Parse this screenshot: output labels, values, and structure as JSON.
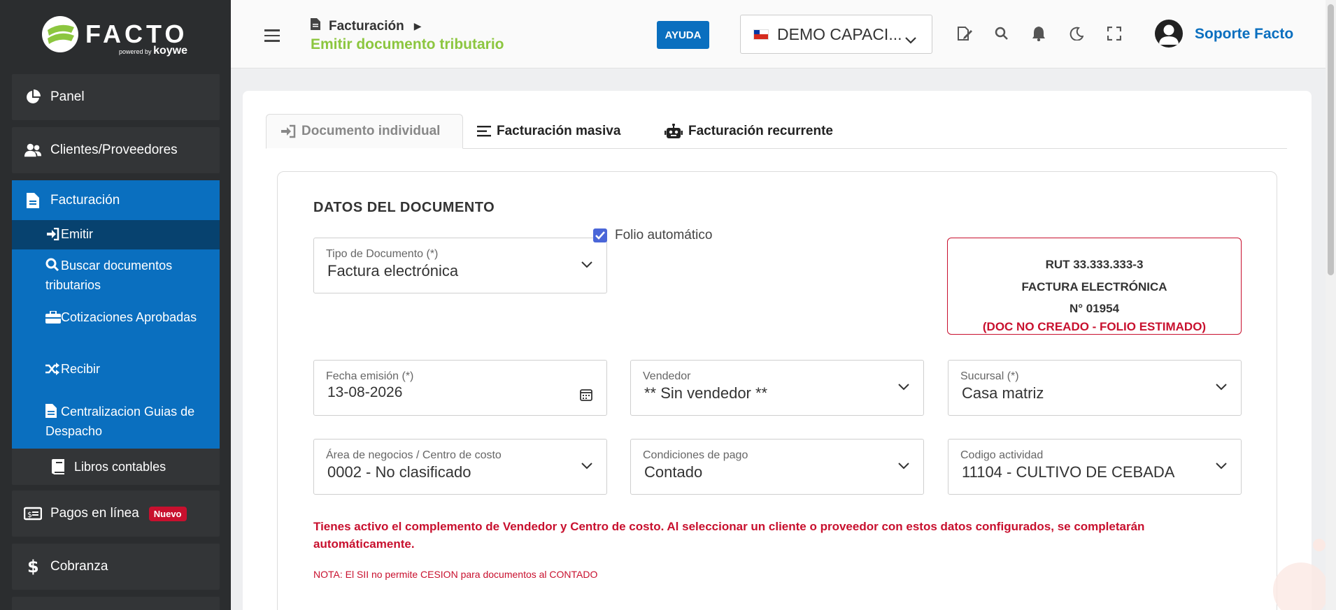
{
  "brand": {
    "name": "FACTO",
    "powered": "powered",
    "by": "by",
    "partner": "koywe"
  },
  "sidebar": {
    "items": [
      {
        "label": "Panel",
        "icon": "pie-chart-icon"
      },
      {
        "label": "Clientes/Proveedores",
        "icon": "users-icon"
      }
    ],
    "facturacion": {
      "label": "Facturación",
      "icon": "file-icon",
      "subitems": [
        {
          "label": "Emitir",
          "icon": "sign-in-icon",
          "active": true
        },
        {
          "label": "Buscar documentos tributarios",
          "icon": "search-icon"
        },
        {
          "label": "Cotizaciones Aprobadas",
          "icon": "briefcase-icon"
        },
        {
          "label": "Recibir",
          "icon": "shuffle-icon"
        },
        {
          "label": "Centralizacion Guias de Despacho",
          "icon": "file-icon"
        }
      ]
    },
    "libros": {
      "label": "Libros contables",
      "icon": "book-icon"
    },
    "pagos": {
      "label": "Pagos en línea",
      "badge": "Nuevo",
      "icon": "money-bill-icon"
    },
    "cobranza": {
      "label": "Cobranza",
      "icon": "dollar-icon"
    }
  },
  "header": {
    "breadcrumb": "Facturación",
    "title": "Emitir documento tributario",
    "help": "AYUDA",
    "company": "DEMO CAPACI...",
    "user": "Soporte Facto"
  },
  "tabs": [
    {
      "label": "Documento individual",
      "icon": "sign-in-icon",
      "active": true
    },
    {
      "label": "Facturación masiva",
      "icon": "list-icon"
    },
    {
      "label": "Facturación recurrente",
      "icon": "robot-icon"
    }
  ],
  "form": {
    "section_title": "DATOS DEL DOCUMENTO",
    "tipo_documento": {
      "label": "Tipo de Documento (*)",
      "value": "Factura electrónica"
    },
    "folio_automatico": {
      "label": "Folio automático",
      "checked": true
    },
    "folio_box": {
      "rut": "RUT 33.333.333-3",
      "doc_type": "FACTURA ELECTRÓNICA",
      "number": "N° 01954",
      "status": "(DOC NO CREADO - FOLIO ESTIMADO)"
    },
    "fecha_emision": {
      "label": "Fecha emisión (*)",
      "value": "13-08-2026"
    },
    "vendedor": {
      "label": "Vendedor",
      "value": "** Sin vendedor **"
    },
    "sucursal": {
      "label": "Sucursal (*)",
      "value": "Casa matriz"
    },
    "area_negocios": {
      "label": "Área de negocios / Centro de costo",
      "value": "0002 - No clasificado"
    },
    "condiciones_pago": {
      "label": "Condiciones de pago",
      "value": "Contado"
    },
    "codigo_actividad": {
      "label": "Codigo actividad",
      "value": "11104 - CULTIVO DE CEBADA"
    },
    "info": "Tienes activo el complemento de Vendedor y Centro de costo. Al seleccionar un cliente o proveedor con estos datos configurados, se completarán automáticamente.",
    "note": "NOTA: El SII no permite CESION para documentos al CONTADO"
  },
  "colors": {
    "sidebar_bg": "#2b2d2f",
    "active_blue": "#0a6fbf",
    "brand_green": "#8cc63f",
    "alert_red": "#c8102e"
  }
}
